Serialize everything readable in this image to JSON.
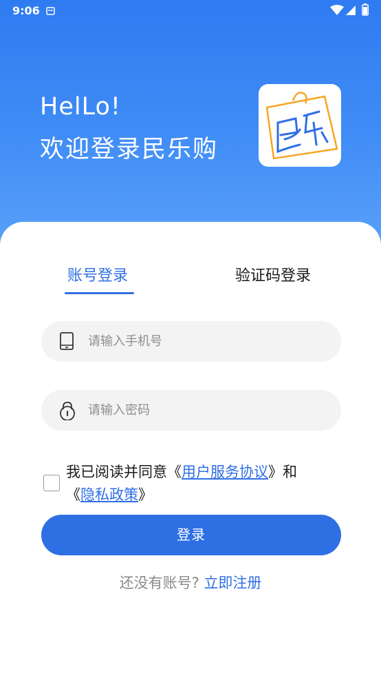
{
  "status_bar": {
    "time": "9:06",
    "icons": [
      "notification-icon",
      "wifi-icon",
      "signal-icon",
      "battery-icon"
    ]
  },
  "hero": {
    "greeting": "HelLo!",
    "welcome": "欢迎登录民乐购"
  },
  "logo": {
    "icon": "shopping-bag-logo-icon",
    "text": "民乐"
  },
  "tabs": [
    {
      "label": "账号登录",
      "active": true
    },
    {
      "label": "验证码登录",
      "active": false
    }
  ],
  "fields": {
    "phone": {
      "placeholder": "请输入手机号",
      "value": "",
      "icon": "phone-icon"
    },
    "password": {
      "placeholder": "请输入密码",
      "value": "",
      "icon": "lock-icon"
    }
  },
  "agreement": {
    "checked": false,
    "prefix": "我已阅读并同意《",
    "service_link": "用户服务协议",
    "middle": "》和",
    "open2": "《",
    "privacy_link": "隐私政策",
    "suffix": "》"
  },
  "login_button": "登录",
  "register": {
    "prompt": "还没有账号?",
    "link": "立即注册"
  },
  "colors": {
    "accent": "#2f6fe4",
    "hero_top": "#2f7bf1",
    "hero_bottom": "#5da3fa",
    "logo_orange": "#f5a623",
    "input_bg": "#f3f3f3"
  }
}
